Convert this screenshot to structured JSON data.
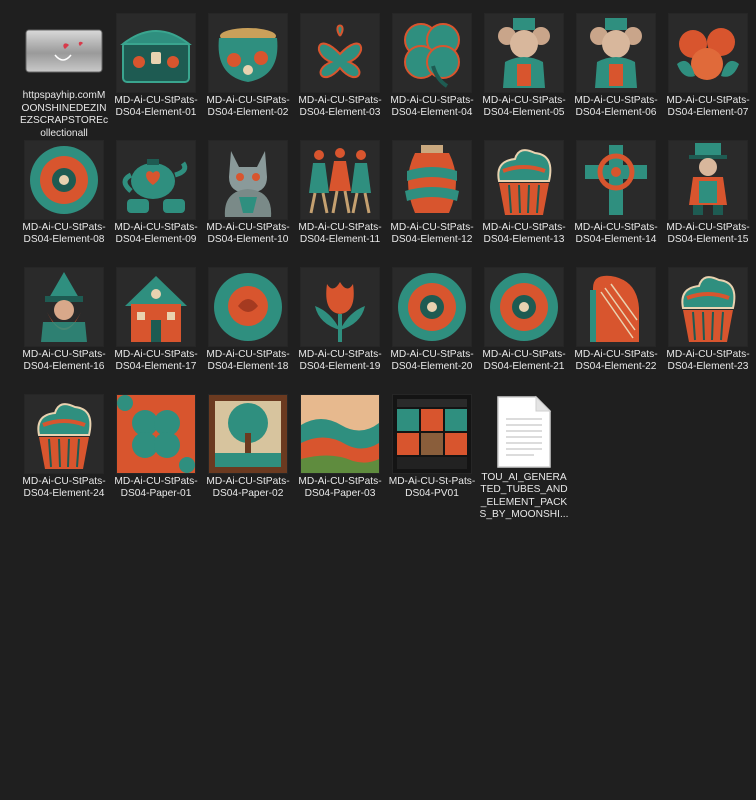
{
  "colors": {
    "background": "#1f1f1f",
    "text": "#e8e8e8",
    "teal": "#2f8f7f",
    "teal_dark": "#1e5b52",
    "orange": "#d8552e",
    "cream": "#e9d2b0"
  },
  "files": [
    {
      "name": "httpspayhip.comMOONSHINEDEZINEZSCRAPSTOREcollectionall",
      "kind": "link",
      "icon": "web-link-icon"
    },
    {
      "name": "MD-Ai-CU-StPats-DS04-Element-01",
      "kind": "image",
      "icon": "treasure-chest-icon"
    },
    {
      "name": "MD-Ai-CU-StPats-DS04-Element-02",
      "kind": "image",
      "icon": "pot-of-gold-icon"
    },
    {
      "name": "MD-Ai-CU-StPats-DS04-Element-03",
      "kind": "image",
      "icon": "shamrock-icon"
    },
    {
      "name": "MD-Ai-CU-StPats-DS04-Element-04",
      "kind": "image",
      "icon": "four-leaf-clover-icon"
    },
    {
      "name": "MD-Ai-CU-StPats-DS04-Element-05",
      "kind": "image",
      "icon": "mouse-leprechaun-icon"
    },
    {
      "name": "MD-Ai-CU-StPats-DS04-Element-06",
      "kind": "image",
      "icon": "mouse-leprechaun-icon"
    },
    {
      "name": "MD-Ai-CU-StPats-DS04-Element-07",
      "kind": "image",
      "icon": "flower-bouquet-icon"
    },
    {
      "name": "MD-Ai-CU-StPats-DS04-Element-08",
      "kind": "image",
      "icon": "flower-icon"
    },
    {
      "name": "MD-Ai-CU-StPats-DS04-Element-09",
      "kind": "image",
      "icon": "teapot-icon"
    },
    {
      "name": "MD-Ai-CU-StPats-DS04-Element-10",
      "kind": "image",
      "icon": "cat-icon"
    },
    {
      "name": "MD-Ai-CU-StPats-DS04-Element-11",
      "kind": "image",
      "icon": "dancers-icon"
    },
    {
      "name": "MD-Ai-CU-StPats-DS04-Element-12",
      "kind": "image",
      "icon": "vase-icon"
    },
    {
      "name": "MD-Ai-CU-StPats-DS04-Element-13",
      "kind": "image",
      "icon": "cupcake-icon"
    },
    {
      "name": "MD-Ai-CU-StPats-DS04-Element-14",
      "kind": "image",
      "icon": "celtic-cross-icon"
    },
    {
      "name": "MD-Ai-CU-StPats-DS04-Element-15",
      "kind": "image",
      "icon": "leprechaun-icon"
    },
    {
      "name": "MD-Ai-CU-StPats-DS04-Element-16",
      "kind": "image",
      "icon": "gnome-icon"
    },
    {
      "name": "MD-Ai-CU-StPats-DS04-Element-17",
      "kind": "image",
      "icon": "house-icon"
    },
    {
      "name": "MD-Ai-CU-StPats-DS04-Element-18",
      "kind": "image",
      "icon": "rose-icon"
    },
    {
      "name": "MD-Ai-CU-StPats-DS04-Element-19",
      "kind": "image",
      "icon": "tulip-icon"
    },
    {
      "name": "MD-Ai-CU-StPats-DS04-Element-20",
      "kind": "image",
      "icon": "flower-icon"
    },
    {
      "name": "MD-Ai-CU-StPats-DS04-Element-21",
      "kind": "image",
      "icon": "flower-icon"
    },
    {
      "name": "MD-Ai-CU-StPats-DS04-Element-22",
      "kind": "image",
      "icon": "harp-icon"
    },
    {
      "name": "MD-Ai-CU-StPats-DS04-Element-23",
      "kind": "image",
      "icon": "cupcake-icon"
    },
    {
      "name": "MD-Ai-CU-StPats-DS04-Element-24",
      "kind": "image",
      "icon": "cupcake-icon"
    },
    {
      "name": "MD-Ai-CU-StPats-DS04-Paper-01",
      "kind": "image",
      "icon": "clover-paper-icon"
    },
    {
      "name": "MD-Ai-CU-StPats-DS04-Paper-02",
      "kind": "image",
      "icon": "tree-paper-icon"
    },
    {
      "name": "MD-Ai-CU-StPats-DS04-Paper-03",
      "kind": "image",
      "icon": "hills-paper-icon"
    },
    {
      "name": "MD-Ai-CU-St-Pats-DS04-PV01",
      "kind": "image",
      "icon": "preview-collage-icon"
    },
    {
      "name": "TOU_AI_GENERATED_TUBES_AND_ELEMENT_PACKS_BY_MOONSHI...",
      "kind": "document",
      "icon": "text-document-icon"
    }
  ]
}
